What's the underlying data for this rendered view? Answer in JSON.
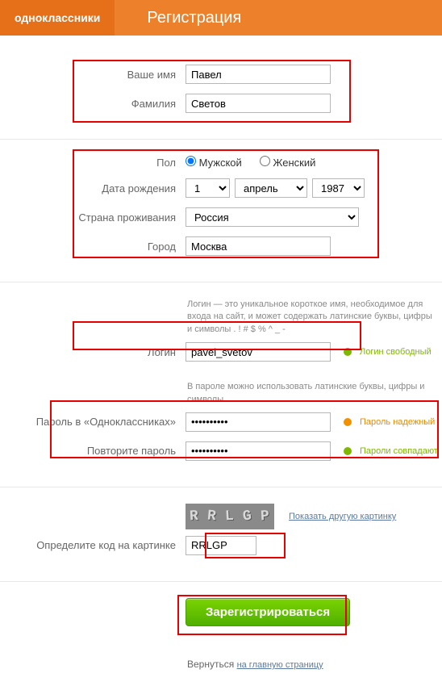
{
  "header": {
    "brand": "одноклассники",
    "title": "Регистрация"
  },
  "name": {
    "first_label": "Ваше имя",
    "first_value": "Павел",
    "last_label": "Фамилия",
    "last_value": "Светов"
  },
  "gender": {
    "label": "Пол",
    "male": "Мужской",
    "female": "Женский"
  },
  "dob": {
    "label": "Дата рождения",
    "day": "1",
    "month": "апрель",
    "year": "1987"
  },
  "country": {
    "label": "Страна проживания",
    "value": "Россия"
  },
  "city": {
    "label": "Город",
    "value": "Москва"
  },
  "login": {
    "hint": "Логин — это уникальное короткое имя, необходимое для входа на сайт, и может содержать латинские буквы, цифры и символы . ! # $ % ^ _ -",
    "label": "Логин",
    "value": "pavel_svetov",
    "status": "Логин свободный"
  },
  "password": {
    "hint": "В пароле можно использовать латинские буквы, цифры и символы",
    "label": "Пароль в «Одноклассниках»",
    "value": "••••••••••",
    "repeat_label": "Повторите пароль",
    "repeat_value": "••••••••••",
    "status_strength": "Пароль надежный",
    "status_match": "Пароли совпадают"
  },
  "captcha": {
    "refresh": "Показать другую картинку",
    "label": "Определите код на картинке",
    "input": "RRLGP",
    "glyphs": [
      "R",
      "R",
      "L",
      "G",
      "P"
    ]
  },
  "submit": "Зарегистрироваться",
  "return": {
    "prefix": "Вернуться ",
    "link": "на главную страницу"
  }
}
